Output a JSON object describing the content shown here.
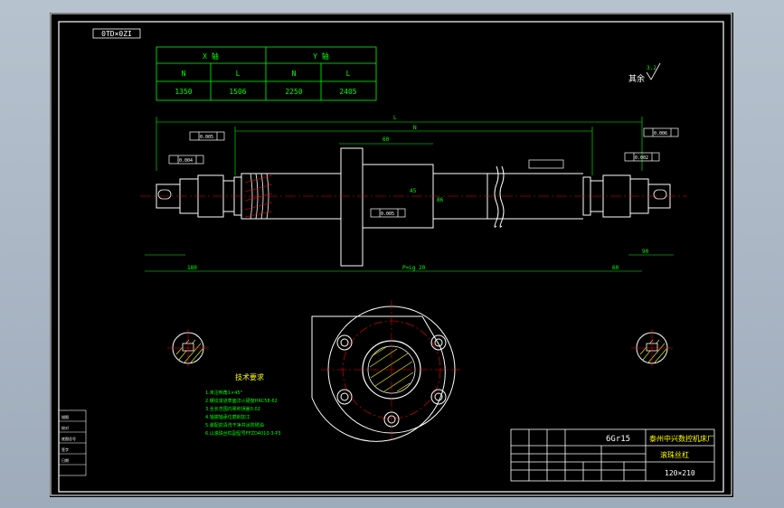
{
  "drawing": {
    "number_stamp": "0TD×0ZI",
    "roughness_note": "其余",
    "roughness_value": "3.2"
  },
  "param_table": {
    "group_x": "X 轴",
    "group_y": "Y 轴",
    "col_n": "N",
    "col_l": "L",
    "x_n": "1350",
    "x_l": "1506",
    "y_n": "2250",
    "y_l": "2405"
  },
  "dims": {
    "overall_L": "L",
    "thread_N": "N",
    "nut_len": "60",
    "nut_dia": "86",
    "mid_dim": "45",
    "left_total": "180",
    "screw_len": "P=Lg 20",
    "right_total": "60",
    "right_small": "90",
    "tol_1": "0.005",
    "tol_2": "0.004",
    "tol_3": "0.005",
    "tol_4": "0.006",
    "tol_5": "0.002"
  },
  "tech_req": {
    "title": "技术要求",
    "items": [
      "1.未注倒角1×45°",
      "2.螺纹滚道表面淬火硬度HRC58-62",
      "3.全长范围内累积误差0.02",
      "4.轴端轴承位磨削加工",
      "5.装配前清洗干净并涂防锈油",
      "6.以滚珠丝杠副型号FFZD4010-3-P3"
    ]
  },
  "title_block": {
    "material": "6Gr15",
    "company": "泰州中兴数控机床厂",
    "part_name": "滚珠丝杠",
    "scale": "120×210"
  },
  "left_strip": [
    "描图",
    "校对",
    "底图总号",
    "签字",
    "日期"
  ],
  "colors": {
    "outline": "#ffffff",
    "dimension": "#00ff00",
    "centerline": "#ff0000",
    "section": "#ffff00",
    "tolerance": "#ffffff",
    "background": "#000000"
  }
}
